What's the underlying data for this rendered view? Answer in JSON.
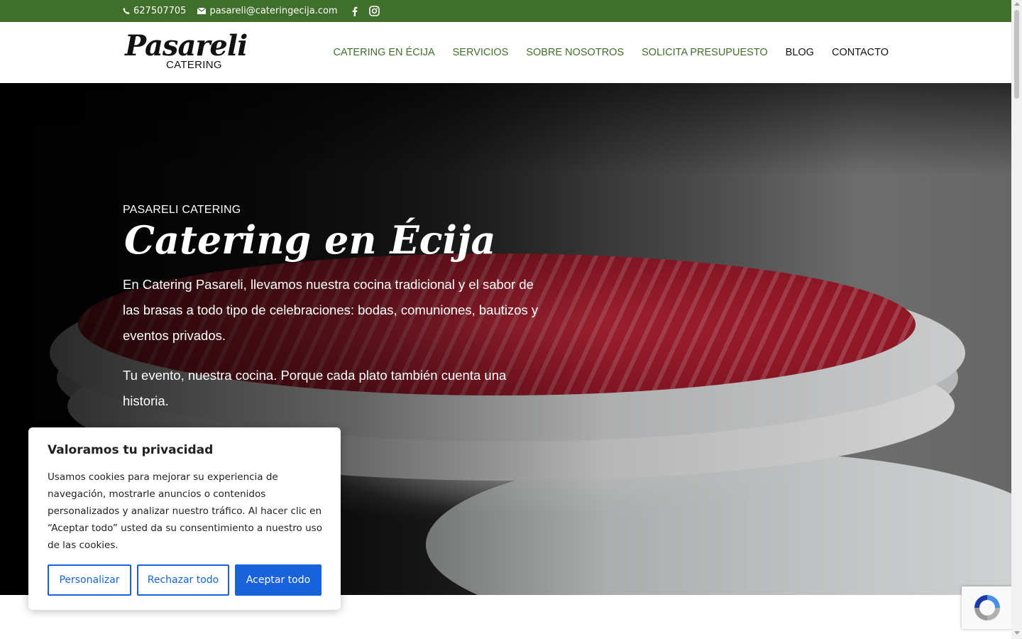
{
  "topbar": {
    "phone": "627507705",
    "email": "pasareli@cateringecija.com",
    "icons": [
      "phone-icon",
      "mail-icon",
      "facebook-icon",
      "instagram-icon"
    ],
    "background_color": "#3f6f2a"
  },
  "logo": {
    "script": "Pasareli",
    "sub": "CATERING"
  },
  "nav": {
    "items": [
      {
        "label": "CATERING EN ÉCIJA"
      },
      {
        "label": "SERVICIOS"
      },
      {
        "label": "SOBRE NOSOTROS"
      },
      {
        "label": "SOLICITA PRESUPUESTO"
      },
      {
        "label": "BLOG"
      },
      {
        "label": "CONTACTO"
      }
    ],
    "accent_color": "#3f6f2a"
  },
  "hero": {
    "eyebrow": "PASARELI CATERING",
    "title": "Catering en Écija",
    "paragraph1": "En Catering Pasareli, llevamos nuestra cocina tradicional y el sabor de las brasas a todo tipo de celebraciones: bodas, comuniones, bautizos y eventos privados.",
    "paragraph2": "Tu evento, nuestra cocina. Porque cada plato también cuenta una historia."
  },
  "cookie": {
    "title": "Valoramos tu privacidad",
    "text": "Usamos cookies para mejorar su experiencia de navegación, mostrarle anuncios o contenidos personalizados y analizar nuestro tráfico. Al hacer clic en “Aceptar todo” usted da su consentimiento a nuestro uso de las cookies.",
    "buttons": {
      "customize": "Personalizar",
      "reject": "Rechazar todo",
      "accept": "Aceptar todo"
    },
    "button_color": "#1863dc"
  }
}
